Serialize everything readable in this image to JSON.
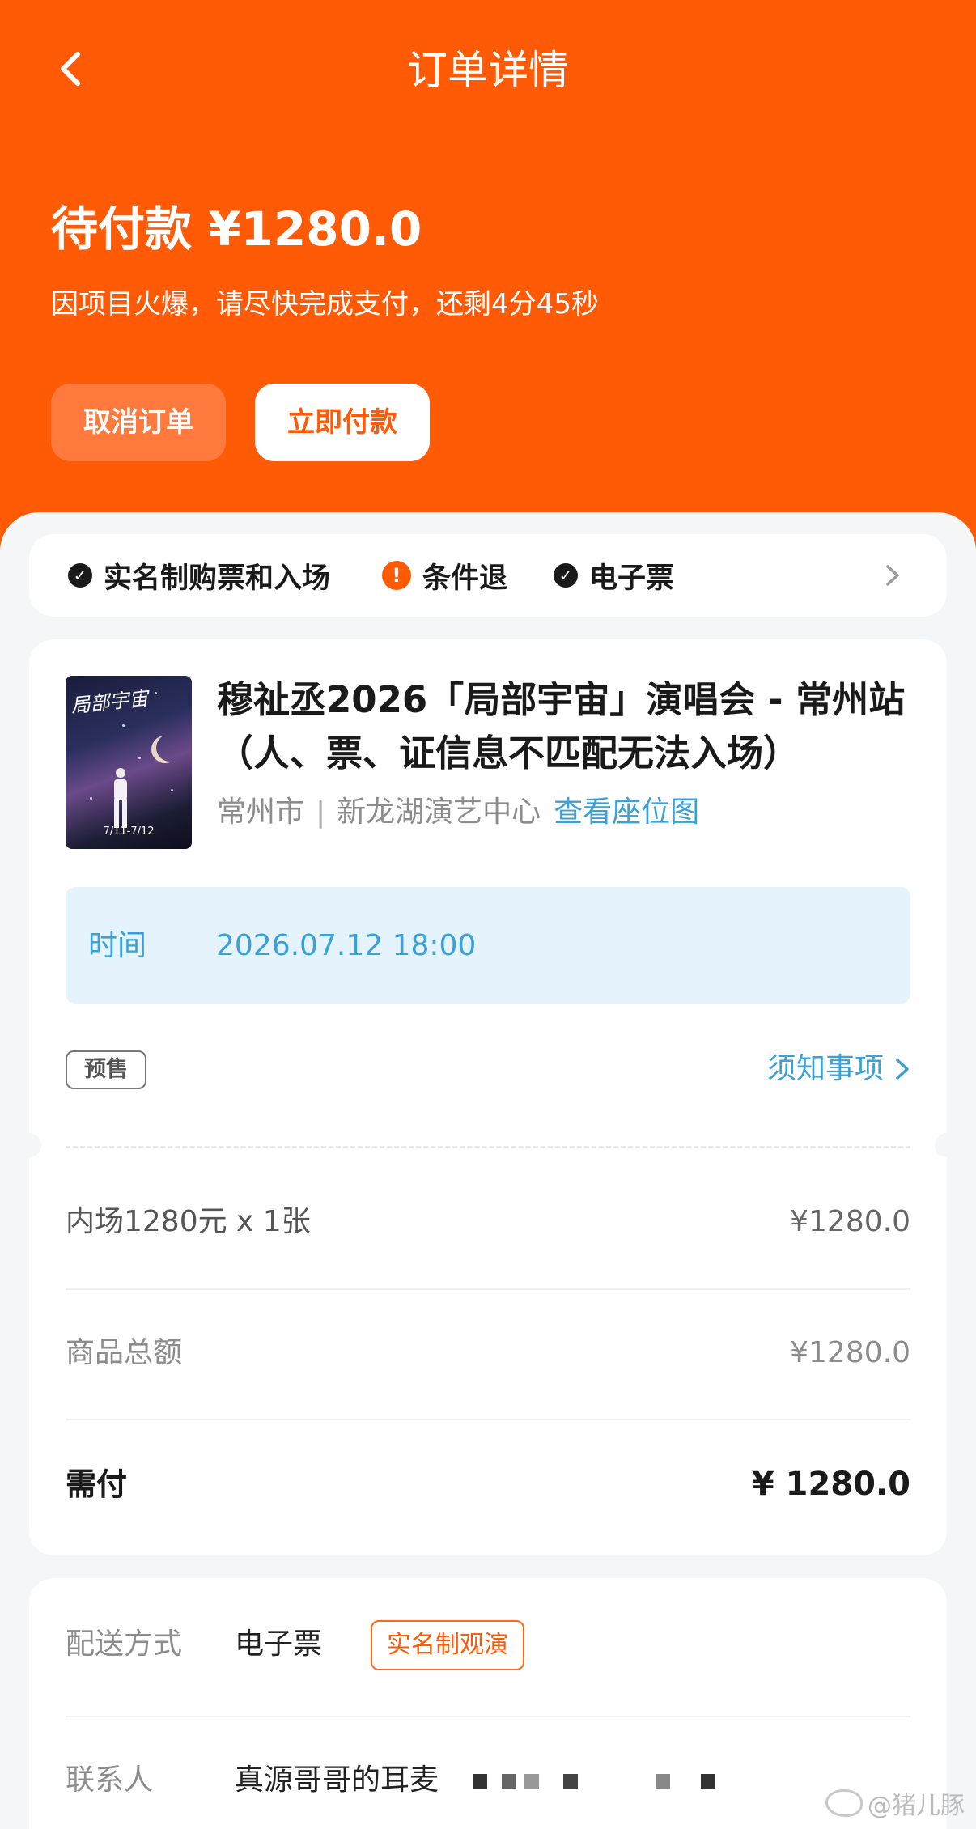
{
  "nav": {
    "title": "订单详情"
  },
  "status": {
    "title": "待付款 ¥1280.0",
    "subtitle": "因项目火爆，请尽快完成支付，还剩4分45秒",
    "cancel_label": "取消订单",
    "pay_label": "立即付款"
  },
  "policies": [
    {
      "label": "实名制购票和入场",
      "icon": "check-circle-icon",
      "color": "#1a1a1a"
    },
    {
      "label": "条件退",
      "icon": "exclamation-circle-icon",
      "color": "#ff5a05"
    },
    {
      "label": "电子票",
      "icon": "check-circle-icon",
      "color": "#1a1a1a"
    }
  ],
  "event": {
    "title": "穆祉丞2026「局部宇宙」演唱会 - 常州站（人、票、证信息不匹配无法入场）",
    "city": "常州市",
    "separator": "|",
    "venue": "新龙湖演艺中心",
    "seat_map_link": "查看座位图",
    "poster_title": "局部宇宙",
    "poster_dates": "7/11-7/12",
    "time_label": "时间",
    "time_value": "2026.07.12 18:00",
    "presale_badge": "预售",
    "notice_link": "须知事项"
  },
  "price_rows": {
    "item_label": "内场1280元 x 1张",
    "item_value": "¥1280.0",
    "subtotal_label": "商品总额",
    "subtotal_value": "¥1280.0",
    "payable_label": "需付",
    "payable_value": "¥ 1280.0"
  },
  "delivery": {
    "method_label": "配送方式",
    "method_value": "电子票",
    "method_tag": "实名制观演",
    "contact_label": "联系人",
    "contact_value": "真源哥哥的耳麦"
  },
  "watermark": "@猪儿豚",
  "colors": {
    "brand_orange": "#ff5a05",
    "link_blue": "#3aa0d8",
    "time_box_bg": "#e4f3fc"
  }
}
